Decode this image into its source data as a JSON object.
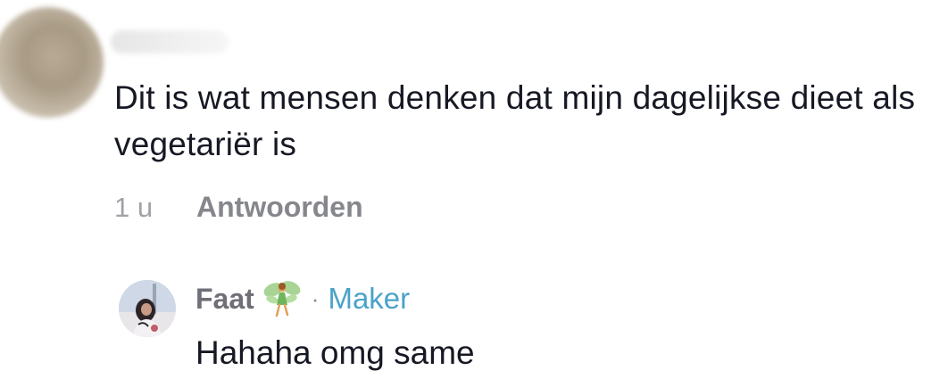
{
  "comment": {
    "text": "Dit is wat mensen denken dat mijn dagelijkse dieet als vegetariër is",
    "time": "1 u",
    "reply_label": "Antwoorden"
  },
  "reply": {
    "username": "Faat",
    "badge_icon": "fairy-icon",
    "separator": "·",
    "role_label": "Maker",
    "text": "Hahaha omg same"
  },
  "colors": {
    "text_primary": "#161823",
    "text_secondary": "#86878d",
    "maker_accent": "#4aa3c8"
  }
}
